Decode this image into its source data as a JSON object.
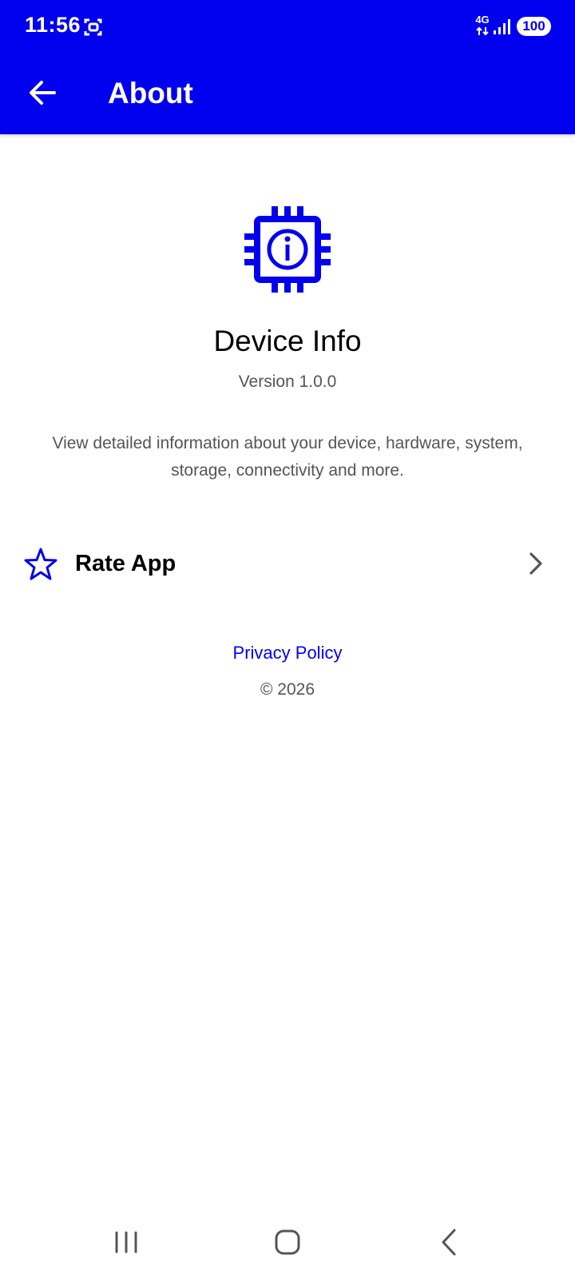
{
  "status_bar": {
    "time": "11:56",
    "network_type": "4G",
    "battery": "100",
    "icons": [
      "screenshot-icon",
      "signal-icon",
      "battery-icon"
    ]
  },
  "toolbar": {
    "title": "About",
    "back_icon": "arrow-left-icon"
  },
  "about": {
    "logo_icon": "chip-info-icon",
    "app_name": "Device Info",
    "version": "Version 1.0.0",
    "description": "View detailed information about your device, hardware, system, storage, connectivity and more."
  },
  "actions": {
    "rate_app": {
      "label": "Rate App",
      "icon": "star-outline-icon",
      "trailing_icon": "chevron-right-icon"
    }
  },
  "footer": {
    "privacy_label": "Privacy Policy",
    "copyright": "© 2026"
  },
  "navigation": {
    "items": [
      "recent-apps-icon",
      "home-icon",
      "back-icon"
    ]
  },
  "colors": {
    "primary": "#0000EE",
    "surface": "#FFFFFF",
    "text_primary": "#000000",
    "text_secondary": "#555555"
  }
}
